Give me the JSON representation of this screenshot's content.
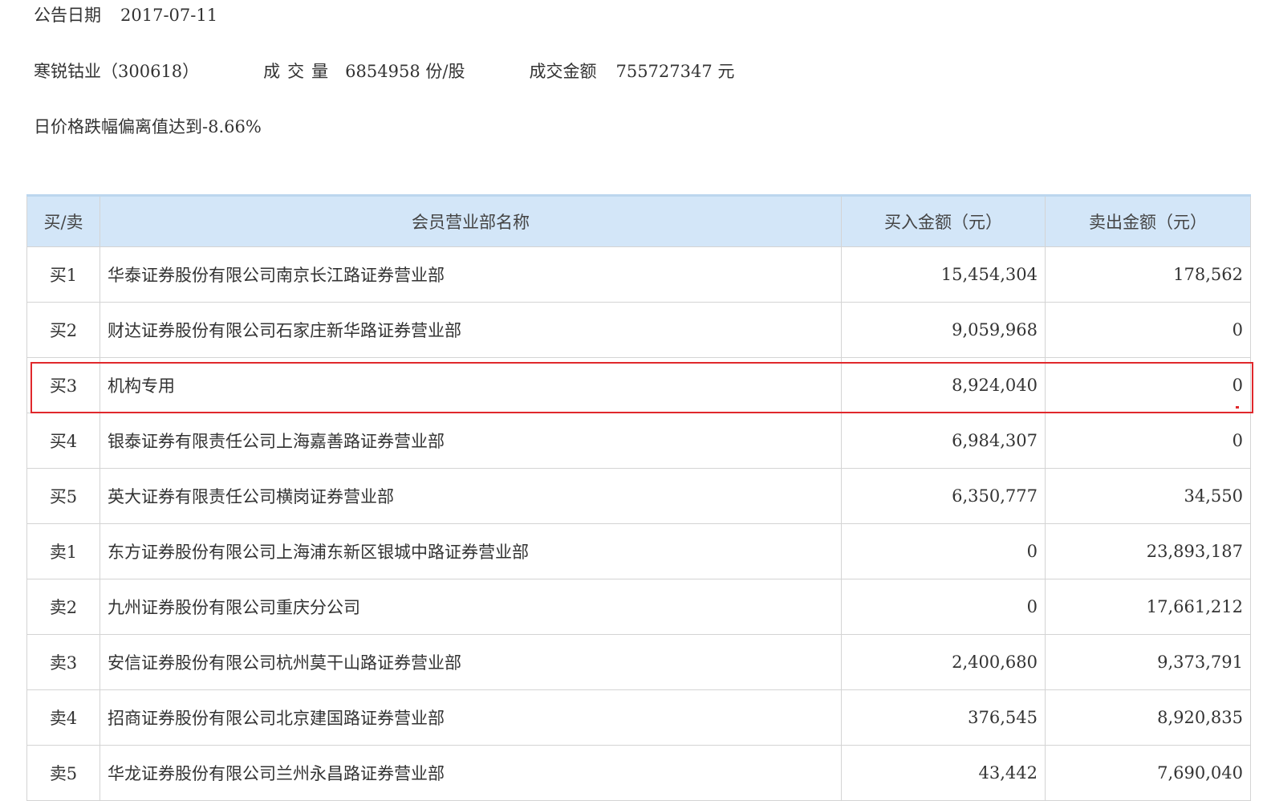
{
  "announcement": {
    "date_label": "公告日期",
    "date_value": "2017-07-11"
  },
  "stock": {
    "name_code": "寒锐钴业（300618）",
    "volume_label": "成交量",
    "volume_value": "6854958",
    "volume_unit": "份/股",
    "amount_label": "成交金额",
    "amount_value": "755727347",
    "amount_unit": "元"
  },
  "description": "日价格跌幅偏离值达到-8.66%",
  "table": {
    "headers": {
      "bs": "买/卖",
      "name": "会员营业部名称",
      "buy": "买入金额（元）",
      "sell": "卖出金额（元）"
    },
    "rows": [
      {
        "bs": "买1",
        "name": "华泰证券股份有限公司南京长江路证券营业部",
        "buy": "15,454,304",
        "sell": "178,562"
      },
      {
        "bs": "买2",
        "name": "财达证券股份有限公司石家庄新华路证券营业部",
        "buy": "9,059,968",
        "sell": "0"
      },
      {
        "bs": "买3",
        "name": "机构专用",
        "buy": "8,924,040",
        "sell": "0"
      },
      {
        "bs": "买4",
        "name": "银泰证券有限责任公司上海嘉善路证券营业部",
        "buy": "6,984,307",
        "sell": "0"
      },
      {
        "bs": "买5",
        "name": "英大证券有限责任公司横岗证券营业部",
        "buy": "6,350,777",
        "sell": "34,550"
      },
      {
        "bs": "卖1",
        "name": "东方证券股份有限公司上海浦东新区银城中路证券营业部",
        "buy": "0",
        "sell": "23,893,187"
      },
      {
        "bs": "卖2",
        "name": "九州证券股份有限公司重庆分公司",
        "buy": "0",
        "sell": "17,661,212"
      },
      {
        "bs": "卖3",
        "name": "安信证券股份有限公司杭州莫干山路证券营业部",
        "buy": "2,400,680",
        "sell": "9,373,791"
      },
      {
        "bs": "卖4",
        "name": "招商证券股份有限公司北京建国路证券营业部",
        "buy": "376,545",
        "sell": "8,920,835"
      },
      {
        "bs": "卖5",
        "name": "华龙证券股份有限公司兰州永昌路证券营业部",
        "buy": "43,442",
        "sell": "7,690,040"
      }
    ]
  },
  "highlight": {
    "row": "买3",
    "color": "#e0282c"
  },
  "colors": {
    "header_bg": "#d3e6f8",
    "table_border": "#d4d4d4",
    "text": "#333333"
  }
}
